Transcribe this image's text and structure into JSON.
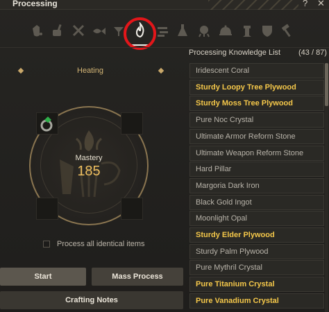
{
  "window": {
    "title": "Processing"
  },
  "tabs": [
    {
      "icon": "shaking-icon"
    },
    {
      "icon": "grinding-icon"
    },
    {
      "icon": "chopping-icon"
    },
    {
      "icon": "drying-icon"
    },
    {
      "icon": "filtering-icon"
    },
    {
      "icon": "heating-icon",
      "active": true
    },
    {
      "icon": "simple-alchemy-icon"
    },
    {
      "icon": "flask-icon"
    },
    {
      "icon": "cooking-pot-icon"
    },
    {
      "icon": "cloche-icon"
    },
    {
      "icon": "tower-icon"
    },
    {
      "icon": "crest-icon"
    },
    {
      "icon": "hammer-icon"
    }
  ],
  "processing": {
    "method": "Heating",
    "mastery_label": "Mastery",
    "mastery_value": "185",
    "process_all_label": "Process all identical items"
  },
  "buttons": {
    "start": "Start",
    "mass_process": "Mass Process",
    "crafting_notes": "Crafting Notes"
  },
  "knowledge": {
    "title": "Processing Knowledge List",
    "count": "(43 / 87)",
    "items": [
      {
        "label": "Iridescent Coral",
        "highlight": false
      },
      {
        "label": "Sturdy Loopy Tree Plywood",
        "highlight": true
      },
      {
        "label": "Sturdy Moss Tree Plywood",
        "highlight": true
      },
      {
        "label": "Pure Noc Crystal",
        "highlight": false
      },
      {
        "label": "Ultimate Armor Reform Stone",
        "highlight": false
      },
      {
        "label": "Ultimate Weapon Reform Stone",
        "highlight": false
      },
      {
        "label": "Hard Pillar",
        "highlight": false
      },
      {
        "label": "Margoria Dark Iron",
        "highlight": false
      },
      {
        "label": "Black Gold Ingot",
        "highlight": false
      },
      {
        "label": "Moonlight Opal",
        "highlight": false
      },
      {
        "label": "Sturdy Elder Plywood",
        "highlight": true
      },
      {
        "label": "Sturdy Palm Plywood",
        "highlight": false
      },
      {
        "label": "Pure Mythril Crystal",
        "highlight": false
      },
      {
        "label": "Pure Titanium Crystal",
        "highlight": true
      },
      {
        "label": "Pure Vanadium Crystal",
        "highlight": true
      }
    ]
  },
  "colors": {
    "highlight_ring": "#e3161a",
    "gold_text": "#f5c84a",
    "mastery_value": "#f0c060"
  }
}
